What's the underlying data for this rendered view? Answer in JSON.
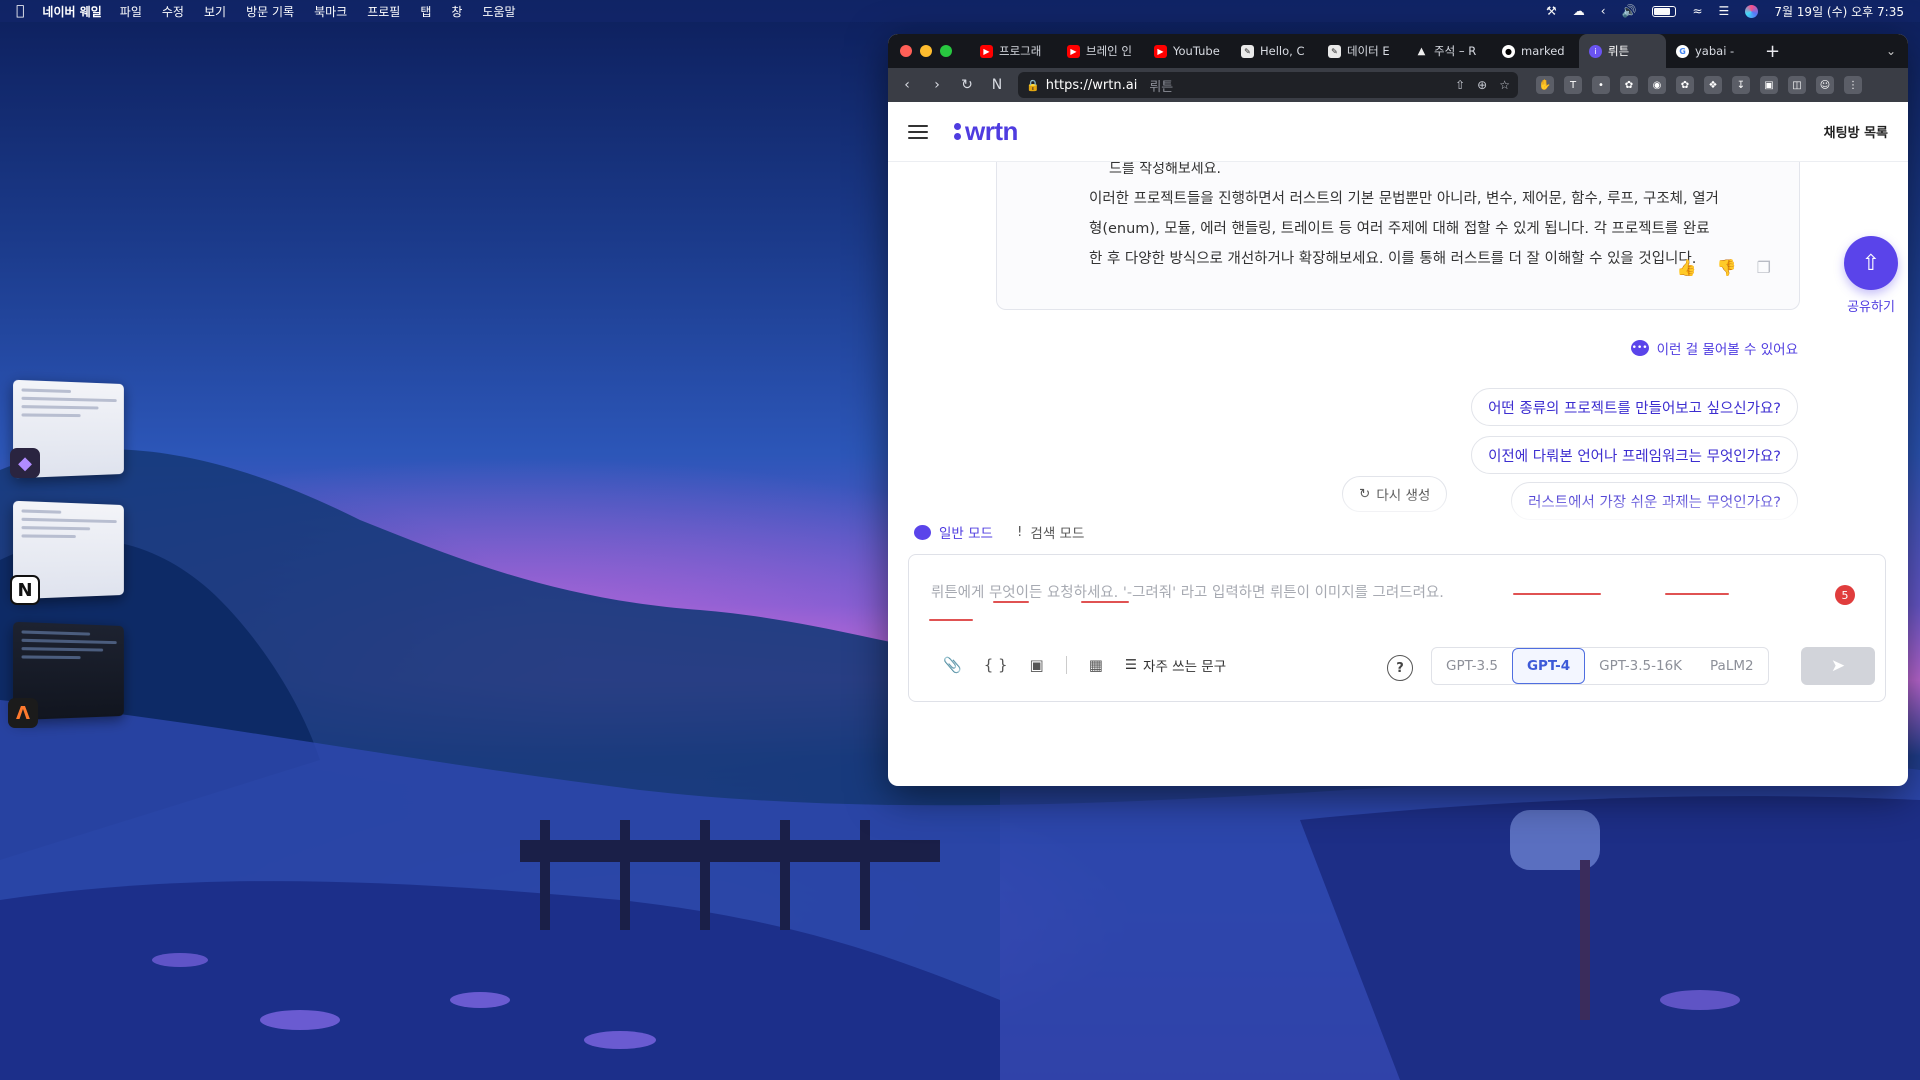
{
  "menubar": {
    "app_name": "네이버 웨일",
    "menus": [
      "파일",
      "수정",
      "보기",
      "방문 기록",
      "북마크",
      "프로필",
      "탭",
      "창",
      "도움말"
    ],
    "clock": "7월 19일 (수) 오후 7:35"
  },
  "browser": {
    "tabs": [
      {
        "label": "프로그래",
        "icon": "youtube-icon"
      },
      {
        "label": "브레인 인",
        "icon": "youtube-icon"
      },
      {
        "label": "YouTube",
        "icon": "youtube-icon"
      },
      {
        "label": "Hello, C",
        "icon": "document-icon"
      },
      {
        "label": "데이터 E",
        "icon": "document-icon"
      },
      {
        "label": "주석 – R",
        "icon": "triangle-icon"
      },
      {
        "label": "marked",
        "icon": "github-icon"
      },
      {
        "label": "뤼튼",
        "icon": "wrtn-icon",
        "active": true
      },
      {
        "label": "yabai -",
        "icon": "google-icon"
      }
    ],
    "url": "https://wrtn.ai",
    "url_title": "뤼튼"
  },
  "page": {
    "logo": "wrtn",
    "chat_list": "채팅방 목록",
    "answer_cut": "드를 작성해보세요.",
    "answer_lines": [
      "이러한 프로젝트들을 진행하면서 러스트의 기본 문법뿐만 아니라, 변수, 제어문, 함수, 루프, 구조체, 열거",
      "형(enum), 모듈, 에러 핸들링, 트레이트 등 여러 주제에 대해 접할 수 있게 됩니다. 각 프로젝트를 완료",
      "한 후 다양한 방식으로 개선하거나 확장해보세요. 이를 통해 러스트를 더 잘 이해할 수 있을 것입니다."
    ],
    "share_label": "공유하기",
    "suggest_header": "이런 걸 물어볼 수 있어요",
    "suggestions": [
      "어떤 종류의 프로젝트를 만들어보고 싶으신가요?",
      "이전에 다뤄본 언어나 프레임워크는 무엇인가요?",
      "러스트에서 가장 쉬운 과제는 무엇인가요?"
    ],
    "regenerate": "다시 생성",
    "modes": {
      "normal": "일반 모드",
      "search": "검색 모드"
    },
    "composer": {
      "placeholder": "뤼튼에게 무엇이든 요청하세요.  '-그려줘' 라고 입력하면 뤼튼이 이미지를 그려드려요.",
      "counter": "5",
      "frequent_phrases": "자주 쓰는 문구",
      "models": [
        "GPT-3.5",
        "GPT-4",
        "GPT-3.5-16K",
        "PaLM2"
      ],
      "selected_model": "GPT-4"
    }
  }
}
